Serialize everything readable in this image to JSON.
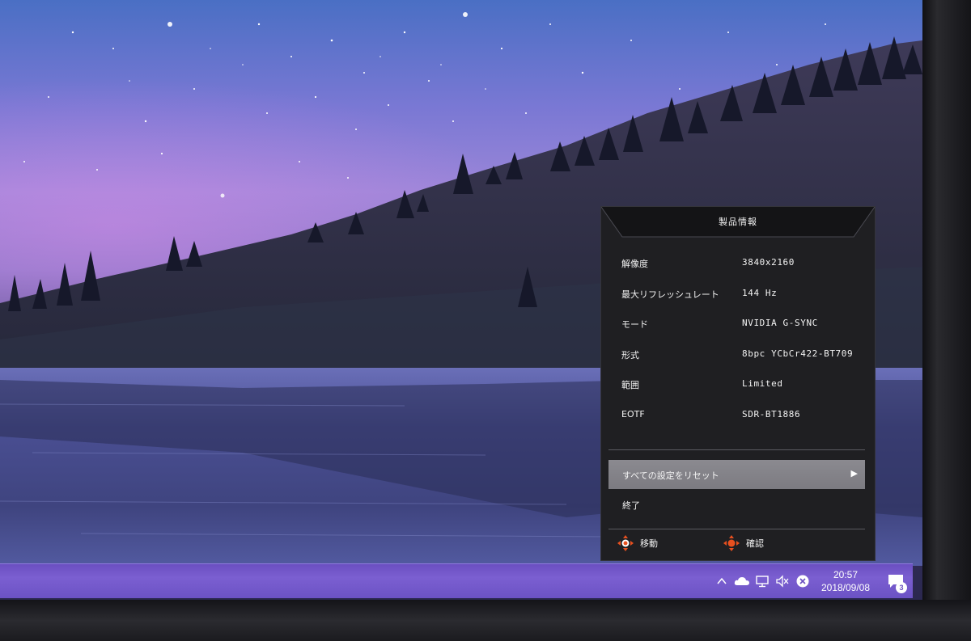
{
  "osd": {
    "title": "製品情報",
    "info": [
      {
        "label": "解像度",
        "value": "3840x2160"
      },
      {
        "label": "最大リフレッシュレート",
        "value": "144 Hz"
      },
      {
        "label": "モード",
        "value": "NVIDIA G-SYNC"
      },
      {
        "label": "形式",
        "value": "8bpc YCbCr422-BT709"
      },
      {
        "label": "範囲",
        "value": "Limited"
      },
      {
        "label": "EOTF",
        "value": "SDR-BT1886"
      }
    ],
    "actions": {
      "reset_label": "すべての設定をリセット",
      "exit_label": "終了"
    },
    "footer": {
      "move_label": "移動",
      "confirm_label": "確認"
    },
    "colors": {
      "panel": "#1f1f22",
      "selected": "#828187",
      "joystick_center": "#e8501f"
    }
  },
  "taskbar": {
    "clock_time": "20:57",
    "clock_date": "2018/09/08",
    "notification_count": "3",
    "tray_icons": [
      "chevron-up-icon",
      "onedrive-cloud-icon",
      "network-icon",
      "volume-muted-icon",
      "close-circle-icon",
      "action-center-icon"
    ],
    "color": "#6f55c8"
  }
}
